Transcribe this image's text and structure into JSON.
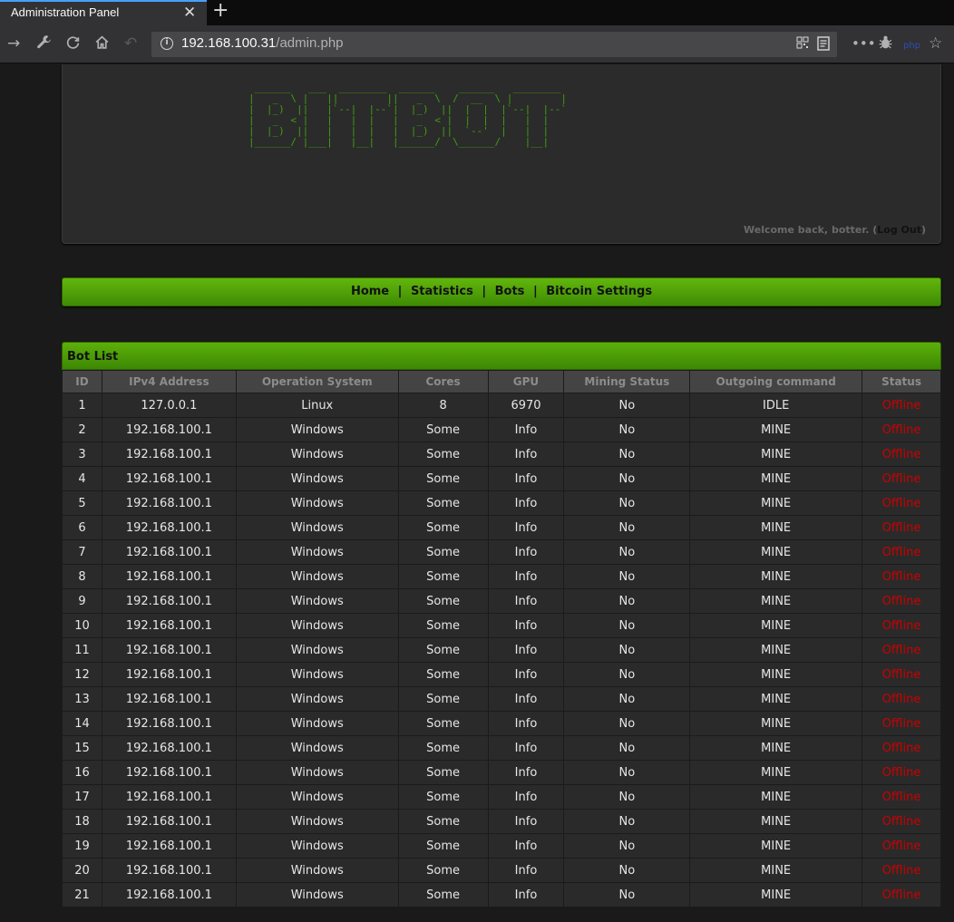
{
  "browser": {
    "tab_title": "Administration Panel",
    "tab_close": "✕",
    "new_tab": "+",
    "url_host": "192.168.100.31",
    "url_path": "/admin.php",
    "icons": [
      "back-arrow-icon",
      "wrench-icon",
      "reload-icon",
      "home-icon",
      "undo-icon",
      "info-icon",
      "qr-icon",
      "reader-icon",
      "more-icon",
      "bug-icon",
      "extension-icon",
      "star-icon"
    ]
  },
  "header": {
    "ascii_logo": " ______   ___  ________  ______    ______   ________\n|   _  \\ |   ||        ||   _  \\  /  __  \\ |        |\n|  |_)  ||   |`--|  |--`|  |_)  ||  |  |  |`--|  |--`\n|   _  < |   |   |  |   |   _  < |  |  |  |   |  |\n|  |_)  ||   |   |  |   |  |_)  ||  `--'  |   |  |\n|______/ |___|   |__|   |______/  \\______/    |__|",
    "welcome_text": "Welcome back, botter. (",
    "logout_label": "Log Out",
    "welcome_end": ")"
  },
  "menu": {
    "home": "Home",
    "statistics": "Statistics",
    "bots": "Bots",
    "bitcoin_settings": "Bitcoin Settings",
    "separator": "|"
  },
  "bot_list": {
    "title": "Bot List",
    "columns": [
      "ID",
      "IPv4 Address",
      "Operation System",
      "Cores",
      "GPU",
      "Mining Status",
      "Outgoing command",
      "Status"
    ],
    "rows": [
      [
        "1",
        "127.0.0.1",
        "Linux",
        "8",
        "6970",
        "No",
        "IDLE",
        "Offline"
      ],
      [
        "2",
        "192.168.100.1",
        "Windows",
        "Some",
        "Info",
        "No",
        "MINE",
        "Offline"
      ],
      [
        "3",
        "192.168.100.1",
        "Windows",
        "Some",
        "Info",
        "No",
        "MINE",
        "Offline"
      ],
      [
        "4",
        "192.168.100.1",
        "Windows",
        "Some",
        "Info",
        "No",
        "MINE",
        "Offline"
      ],
      [
        "5",
        "192.168.100.1",
        "Windows",
        "Some",
        "Info",
        "No",
        "MINE",
        "Offline"
      ],
      [
        "6",
        "192.168.100.1",
        "Windows",
        "Some",
        "Info",
        "No",
        "MINE",
        "Offline"
      ],
      [
        "7",
        "192.168.100.1",
        "Windows",
        "Some",
        "Info",
        "No",
        "MINE",
        "Offline"
      ],
      [
        "8",
        "192.168.100.1",
        "Windows",
        "Some",
        "Info",
        "No",
        "MINE",
        "Offline"
      ],
      [
        "9",
        "192.168.100.1",
        "Windows",
        "Some",
        "Info",
        "No",
        "MINE",
        "Offline"
      ],
      [
        "10",
        "192.168.100.1",
        "Windows",
        "Some",
        "Info",
        "No",
        "MINE",
        "Offline"
      ],
      [
        "11",
        "192.168.100.1",
        "Windows",
        "Some",
        "Info",
        "No",
        "MINE",
        "Offline"
      ],
      [
        "12",
        "192.168.100.1",
        "Windows",
        "Some",
        "Info",
        "No",
        "MINE",
        "Offline"
      ],
      [
        "13",
        "192.168.100.1",
        "Windows",
        "Some",
        "Info",
        "No",
        "MINE",
        "Offline"
      ],
      [
        "14",
        "192.168.100.1",
        "Windows",
        "Some",
        "Info",
        "No",
        "MINE",
        "Offline"
      ],
      [
        "15",
        "192.168.100.1",
        "Windows",
        "Some",
        "Info",
        "No",
        "MINE",
        "Offline"
      ],
      [
        "16",
        "192.168.100.1",
        "Windows",
        "Some",
        "Info",
        "No",
        "MINE",
        "Offline"
      ],
      [
        "17",
        "192.168.100.1",
        "Windows",
        "Some",
        "Info",
        "No",
        "MINE",
        "Offline"
      ],
      [
        "18",
        "192.168.100.1",
        "Windows",
        "Some",
        "Info",
        "No",
        "MINE",
        "Offline"
      ],
      [
        "19",
        "192.168.100.1",
        "Windows",
        "Some",
        "Info",
        "No",
        "MINE",
        "Offline"
      ],
      [
        "20",
        "192.168.100.1",
        "Windows",
        "Some",
        "Info",
        "No",
        "MINE",
        "Offline"
      ],
      [
        "21",
        "192.168.100.1",
        "Windows",
        "Some",
        "Info",
        "No",
        "MINE",
        "Offline"
      ]
    ]
  },
  "colors": {
    "accent_green": "#4fa00a",
    "offline_red": "#cc0000",
    "ascii_green": "#3f9f12"
  }
}
